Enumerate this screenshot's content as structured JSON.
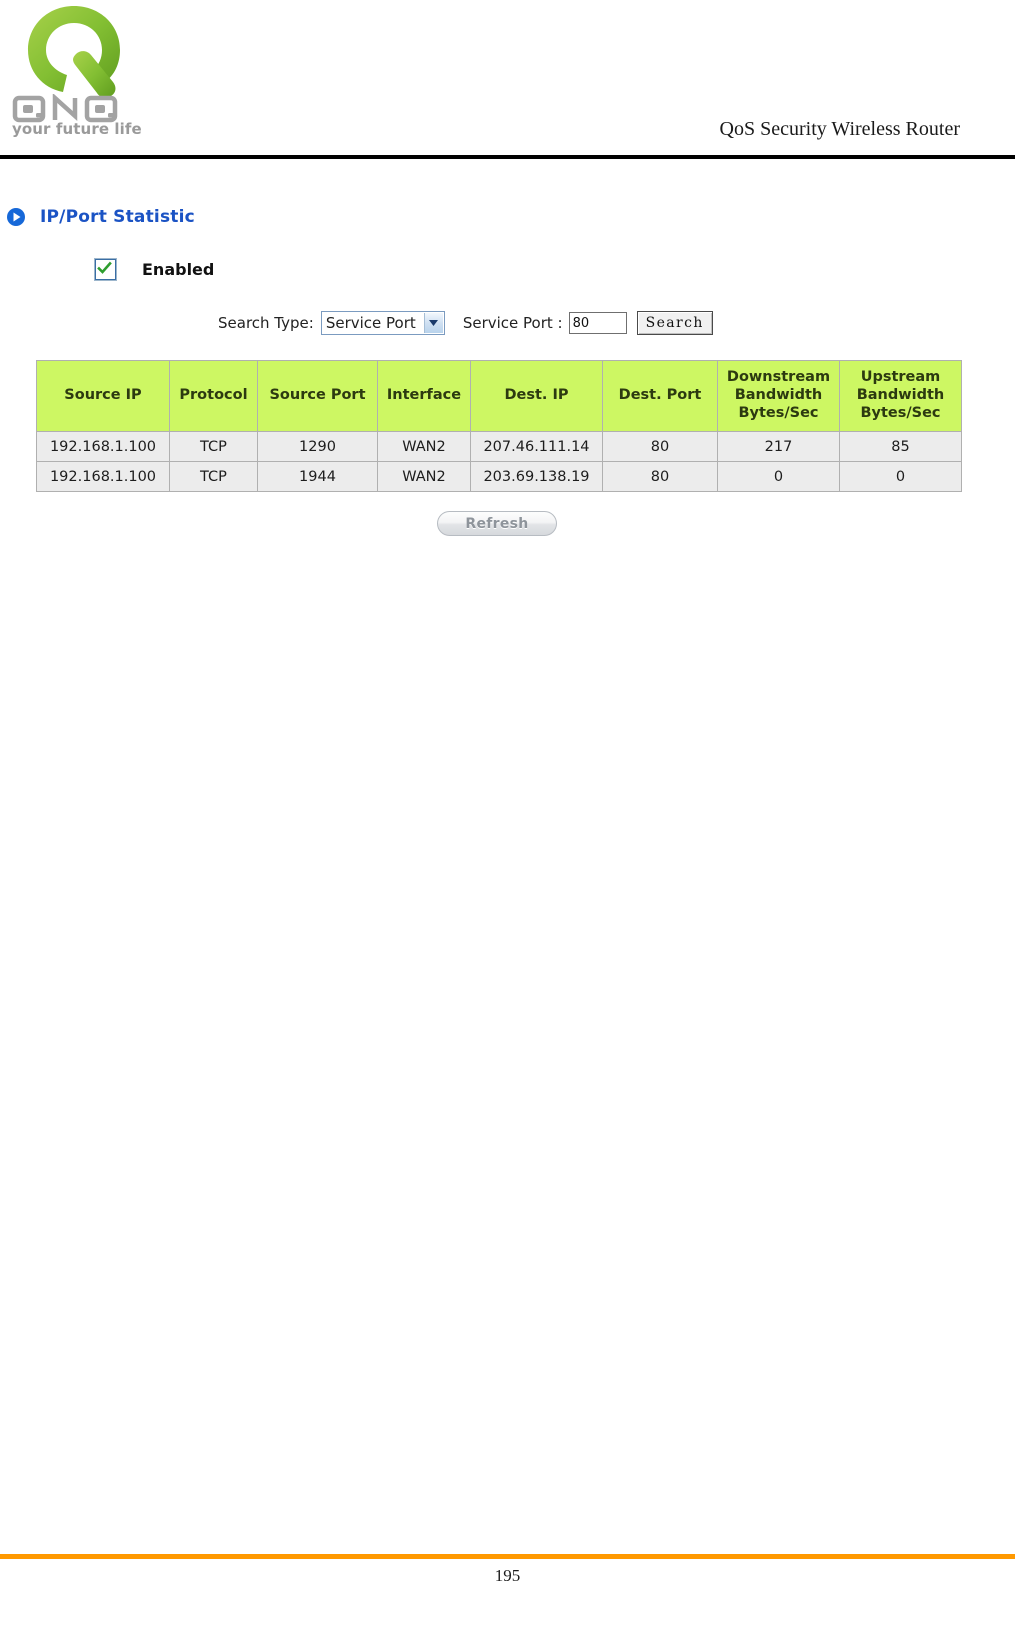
{
  "header": {
    "brand_name": "QNO",
    "tagline": "your future life",
    "title": "QoS Security Wireless Router",
    "logo_green": "#8cc63e",
    "logo_gray": "#9a9a9a",
    "rule_color": "#000000"
  },
  "section": {
    "bullet_icon": "play-circle-icon",
    "title": "IP/Port Statistic",
    "title_color": "#1b53c4"
  },
  "enabled": {
    "label": "Enabled",
    "checked": true,
    "check_color": "#2f9e2f"
  },
  "search": {
    "search_type_label": "Search Type:",
    "search_type_value": "Service Port",
    "search_type_options": [
      "Service Port"
    ],
    "service_port_label": "Service Port :",
    "service_port_value": "80",
    "service_port_placeholder": "",
    "search_button_label": "Search",
    "dropdown_icon": "chevron-down-icon"
  },
  "table": {
    "header_bg": "#cdf763",
    "row_bg": "#ececec",
    "columns": [
      "Source IP",
      "Protocol",
      "Source Port",
      "Interface",
      "Dest. IP",
      "Dest. Port",
      "Downstream Bandwidth Bytes/Sec",
      "Upstream Bandwidth Bytes/Sec"
    ],
    "columns_multiline": [
      [
        "Source IP"
      ],
      [
        "Protocol"
      ],
      [
        "Source Port"
      ],
      [
        "Interface"
      ],
      [
        "Dest. IP"
      ],
      [
        "Dest. Port"
      ],
      [
        "Downstream",
        "Bandwidth",
        "Bytes/Sec"
      ],
      [
        "Upstream",
        "Bandwidth",
        "Bytes/Sec"
      ]
    ],
    "rows": [
      {
        "source_ip": "192.168.1.100",
        "protocol": "TCP",
        "source_port": "1290",
        "interface": "WAN2",
        "dest_ip": "207.46.111.14",
        "dest_port": "80",
        "downstream_bandwidth": "217",
        "upstream_bandwidth": "85"
      },
      {
        "source_ip": "192.168.1.100",
        "protocol": "TCP",
        "source_port": "1944",
        "interface": "WAN2",
        "dest_ip": "203.69.138.19",
        "dest_port": "80",
        "downstream_bandwidth": "0",
        "upstream_bandwidth": "0"
      }
    ]
  },
  "refresh": {
    "label": "Refresh"
  },
  "footer": {
    "page_number": "195",
    "rule_color": "#ff9900"
  }
}
